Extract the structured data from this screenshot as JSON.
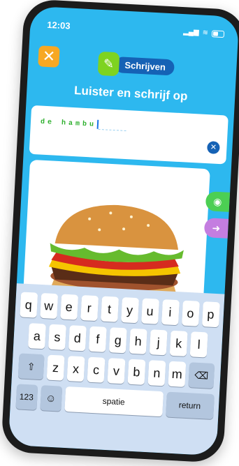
{
  "status": {
    "time": "12:03",
    "signal": "▂▄▆",
    "wifi": "≋"
  },
  "header": {
    "close_glyph": "✕",
    "badge_icon_glyph": "✎",
    "badge_label": "Schrijven",
    "title": "Luister en schrijf op"
  },
  "answer": {
    "typed_chars": [
      "d",
      "e",
      " ",
      "h",
      "a",
      "m",
      "b",
      "u"
    ],
    "clear_glyph": "✕"
  },
  "image": {
    "subject": "hamburger"
  },
  "side_buttons": {
    "eye_glyph": "◉",
    "next_glyph": "➜"
  },
  "keyboard": {
    "row1": [
      "q",
      "w",
      "e",
      "r",
      "t",
      "y",
      "u",
      "i",
      "o",
      "p"
    ],
    "row2": [
      "a",
      "s",
      "d",
      "f",
      "g",
      "h",
      "j",
      "k",
      "l"
    ],
    "row3": [
      "z",
      "x",
      "c",
      "v",
      "b",
      "n",
      "m"
    ],
    "shift": "⇧",
    "backspace": "⌫",
    "numbers": "123",
    "emoji": "☺",
    "space": "spatie",
    "return": "return"
  },
  "colors": {
    "accent_blue": "#2db8ef",
    "orange": "#f7a823",
    "green": "#7ed321",
    "navy": "#1562b5"
  }
}
